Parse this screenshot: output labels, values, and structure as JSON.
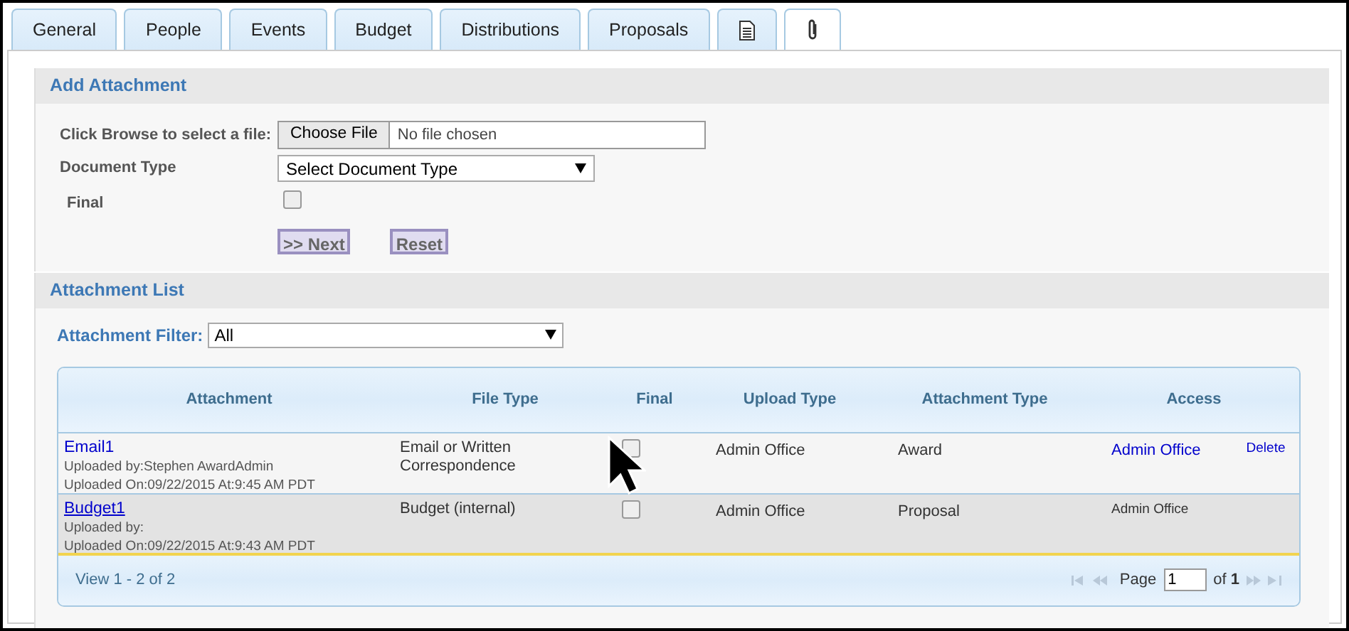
{
  "tabs": [
    {
      "label": "General",
      "kind": "text",
      "selected": false
    },
    {
      "label": "People",
      "kind": "text",
      "selected": false
    },
    {
      "label": "Events",
      "kind": "text",
      "selected": false
    },
    {
      "label": "Budget",
      "kind": "text",
      "selected": false
    },
    {
      "label": "Distributions",
      "kind": "text",
      "selected": false
    },
    {
      "label": "Proposals",
      "kind": "text",
      "selected": false
    },
    {
      "kind": "document",
      "selected": false
    },
    {
      "kind": "paperclip",
      "selected": true
    }
  ],
  "add_attachment": {
    "title": "Add Attachment",
    "file_label": "Click Browse to select a file:",
    "file_button": "Choose File",
    "file_status": "No file chosen",
    "doctype_label": "Document Type",
    "doctype_value": "Select Document Type",
    "final_label": "Final",
    "final_checked": false,
    "buttons": [
      ">> Next",
      "Reset"
    ]
  },
  "attachment_list": {
    "title": "Attachment List",
    "filter_label": "Attachment Filter:",
    "filter_value": "All",
    "table": {
      "columns": [
        "Attachment",
        "File Type",
        "Final",
        "Upload Type",
        "Attachment Type",
        "Access"
      ],
      "rows": [
        {
          "name": "Email1",
          "uploaded_by": "Uploaded by:Stephen AwardAdmin",
          "uploaded_on": "Uploaded On:09/22/2015 At:9:45 AM PDT",
          "file_type": "Email or Written Correspondence",
          "final": false,
          "upload_type": "Admin Office",
          "attachment_type": "Award",
          "access": "Admin Office",
          "access_link": true,
          "action": "Delete",
          "selected": false
        },
        {
          "name": "Budget1",
          "uploaded_by": "Uploaded by:",
          "uploaded_on": "Uploaded On:09/22/2015 At:9:43 AM PDT",
          "file_type": "Budget (internal)",
          "final": false,
          "upload_type": "Admin Office",
          "attachment_type": "Proposal",
          "access": "Admin Office",
          "access_link": false,
          "selected": true
        }
      ],
      "footer": {
        "view": "View 1 - 2 of 2",
        "page_label": "Page",
        "page_value": "1",
        "of_label": "of",
        "total": "1"
      }
    }
  }
}
